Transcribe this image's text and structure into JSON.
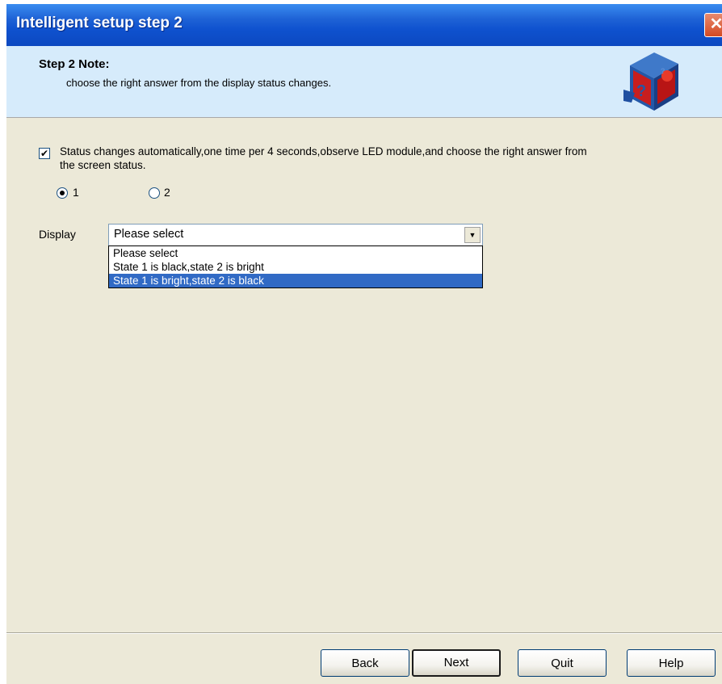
{
  "window": {
    "title": "Intelligent setup step 2",
    "close_symbol": "✕"
  },
  "header": {
    "note_title": "Step 2 Note:",
    "note_text": "choose the right answer from the display status changes.",
    "icon": "setup-cube-icon"
  },
  "form": {
    "auto_change_checked": true,
    "auto_change_label": "Status changes automatically,one time per 4 seconds,observe LED module,and choose the right answer from the screen status.",
    "radios": [
      {
        "label": "1",
        "checked": true
      },
      {
        "label": "2",
        "checked": false
      }
    ],
    "display_label": "Display",
    "display_value": "Please select",
    "display_options": [
      "Please select",
      "State 1 is black,state 2 is bright",
      "State 1 is bright,state 2 is black"
    ],
    "highlighted_option": "State 1 is bright,state 2 is black"
  },
  "buttons": {
    "back": "Back",
    "next": "Next",
    "quit": "Quit",
    "help": "Help"
  },
  "colors": {
    "titlebar": "#0c48c0",
    "header_bg": "#d6ebfb",
    "body_bg": "#ece9d8",
    "selection": "#316ac5"
  }
}
